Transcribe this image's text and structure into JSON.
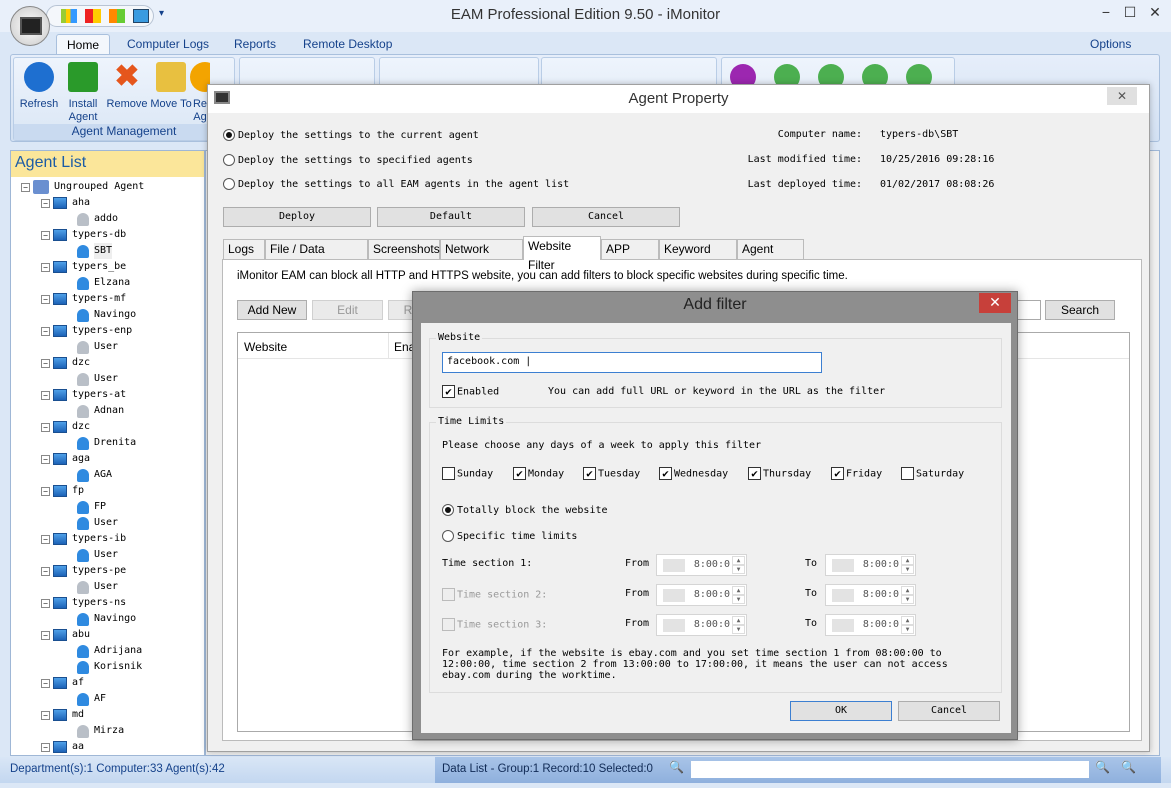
{
  "app": {
    "title": "EAM Professional Edition 9.50 - iMonitor",
    "options": "Options",
    "min": "−",
    "max": "☐",
    "close": "✕"
  },
  "ribbon": {
    "tabs": [
      "Home",
      "Computer Logs",
      "Reports",
      "Remote Desktop"
    ],
    "agent_management": {
      "label": "Agent Management",
      "buttons": [
        {
          "label": "Refresh",
          "icon": "refresh-icon",
          "color": "#1e6fd0"
        },
        {
          "label": "Install Agent",
          "icon": "install-agent-icon",
          "color": "#2a9a2a"
        },
        {
          "label": "Remove",
          "icon": "remove-icon",
          "color": "#e5561c"
        },
        {
          "label": "Move To",
          "icon": "move-to-icon",
          "color": "#e8c040"
        },
        {
          "label": "Re Ag",
          "icon": "reinstall-icon",
          "color": "#f3a400"
        }
      ]
    }
  },
  "agent_list": {
    "title": "Agent List",
    "root": "Ungrouped Agent",
    "computers": [
      {
        "name": "aha",
        "users": [
          {
            "name": "addo",
            "online": false
          }
        ]
      },
      {
        "name": "typers-db",
        "users": [
          {
            "name": "SBT",
            "online": true
          }
        ]
      },
      {
        "name": "typers_be",
        "users": [
          {
            "name": "Elzana",
            "online": true
          }
        ]
      },
      {
        "name": "typers-mf",
        "users": [
          {
            "name": "Navingo",
            "online": true
          }
        ]
      },
      {
        "name": "typers-enp",
        "users": [
          {
            "name": "User",
            "online": false
          }
        ]
      },
      {
        "name": "dzc",
        "users": [
          {
            "name": "User",
            "online": false
          }
        ]
      },
      {
        "name": "typers-at",
        "users": [
          {
            "name": "Adnan",
            "online": false
          }
        ]
      },
      {
        "name": "dzc",
        "users": [
          {
            "name": "Drenita",
            "online": true
          }
        ]
      },
      {
        "name": "aga",
        "users": [
          {
            "name": "AGA",
            "online": true
          }
        ]
      },
      {
        "name": "fp",
        "users": [
          {
            "name": "FP",
            "online": true
          },
          {
            "name": "User",
            "online": true
          }
        ]
      },
      {
        "name": "typers-ib",
        "users": [
          {
            "name": "User",
            "online": true
          }
        ]
      },
      {
        "name": "typers-pe",
        "users": [
          {
            "name": "User",
            "online": false
          }
        ]
      },
      {
        "name": "typers-ns",
        "users": [
          {
            "name": "Navingo",
            "online": true
          }
        ]
      },
      {
        "name": "abu",
        "users": [
          {
            "name": "Adrijana",
            "online": true
          },
          {
            "name": "Korisnik",
            "online": true
          }
        ]
      },
      {
        "name": "af",
        "users": [
          {
            "name": "AF",
            "online": true
          }
        ]
      },
      {
        "name": "md",
        "users": [
          {
            "name": "Mirza",
            "online": false
          }
        ]
      },
      {
        "name": "aa",
        "users": []
      }
    ]
  },
  "agent_property": {
    "title": "Agent Property",
    "deploy_options": [
      {
        "label": "Deploy the settings to the current agent",
        "selected": true
      },
      {
        "label": "Deploy the settings to specified agents",
        "selected": false
      },
      {
        "label": "Deploy the settings to all EAM agents in the agent list",
        "selected": false
      }
    ],
    "info": [
      {
        "label": "Computer name:",
        "value": "typers-db\\SBT"
      },
      {
        "label": "Last modified time:",
        "value": "10/25/2016 09:28:16"
      },
      {
        "label": "Last deployed time:",
        "value": "01/02/2017 08:08:26"
      }
    ],
    "buttons": {
      "deploy": "Deploy",
      "default": "Default",
      "cancel": "Cancel"
    },
    "tabs": [
      "Logs",
      "File / Data Security",
      "Screenshots",
      "Network Traffic",
      "Website Filter",
      "APP Filter",
      "Keyword Filter",
      "Agent Alerts"
    ],
    "active_tab": "Website Filter",
    "description": "iMonitor EAM can block all HTTP and HTTPS website, you can add filters to block specific websites during specific time.",
    "toolbar": {
      "add_new": "Add New",
      "edit": "Edit",
      "remove": "R",
      "search": "Search"
    },
    "columns": [
      "Website",
      "Ena"
    ]
  },
  "add_filter": {
    "title": "Add filter",
    "close": "✕",
    "website_legend": "Website",
    "website_value": "facebook.com |",
    "enabled_label": "Enabled",
    "enabled": true,
    "hint": "You can add full URL or keyword in the URL as the filter",
    "time_legend": "Time Limits",
    "days_prompt": "Please choose any days of a week to apply this filter",
    "days": [
      {
        "label": "Sunday",
        "checked": false
      },
      {
        "label": "Monday",
        "checked": true
      },
      {
        "label": "Tuesday",
        "checked": true
      },
      {
        "label": "Wednesday",
        "checked": true
      },
      {
        "label": "Thursday",
        "checked": true
      },
      {
        "label": "Friday",
        "checked": true
      },
      {
        "label": "Saturday",
        "checked": false
      }
    ],
    "modes": [
      {
        "label": "Totally block the website",
        "selected": true
      },
      {
        "label": "Specific time limits",
        "selected": false
      }
    ],
    "sections": [
      {
        "label": "Time section 1:",
        "from_label": "From",
        "from": "8:00:0",
        "to_label": "To",
        "to": "8:00:0",
        "has_checkbox": false
      },
      {
        "label": "Time section 2:",
        "from_label": "From",
        "from": "8:00:0",
        "to_label": "To",
        "to": "8:00:0",
        "has_checkbox": true
      },
      {
        "label": "Time section 3:",
        "from_label": "From",
        "from": "8:00:0",
        "to_label": "To",
        "to": "8:00:0",
        "has_checkbox": true
      }
    ],
    "example": "For example, if the website is ebay.com and you set  time section 1 from 08:00:00 to 12:00:00, time section 2 from 13:00:00 to 17:00:00, it means the user can not access ebay.com during the worktime.",
    "ok": "OK",
    "cancel": "Cancel"
  },
  "status": {
    "left": "Department(s):1  Computer:33  Agent(s):42",
    "right": "Data List - Group:1  Record:10  Selected:0"
  }
}
